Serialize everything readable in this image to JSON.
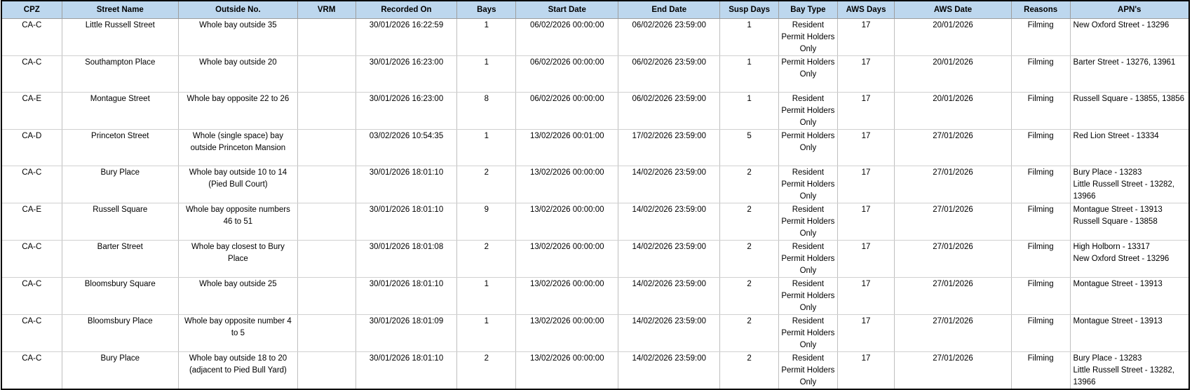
{
  "columns": [
    "CPZ",
    "Street Name",
    "Outside No.",
    "VRM",
    "Recorded On",
    "Bays",
    "Start Date",
    "End Date",
    "Susp Days",
    "Bay Type",
    "AWS Days",
    "AWS Date",
    "Reasons",
    "APN's"
  ],
  "rows": [
    {
      "cpz": "CA-C",
      "street": "Little Russell Street",
      "outside": "Whole bay outside 35",
      "vrm": "",
      "recorded": "30/01/2026 16:22:59",
      "bays": "1",
      "start": "06/02/2026 00:00:00",
      "end": "06/02/2026 23:59:00",
      "susp": "1",
      "bay_type": "Resident Permit Holders Only",
      "aws_days": "17",
      "aws_date": "20/01/2026",
      "reason": "Filming",
      "apns": [
        "New Oxford Street - 13296"
      ]
    },
    {
      "cpz": "CA-C",
      "street": "Southampton Place",
      "outside": "Whole bay outside 20",
      "vrm": "",
      "recorded": "30/01/2026 16:23:00",
      "bays": "1",
      "start": "06/02/2026 00:00:00",
      "end": "06/02/2026 23:59:00",
      "susp": "1",
      "bay_type": "Permit Holders Only",
      "aws_days": "17",
      "aws_date": "20/01/2026",
      "reason": "Filming",
      "apns": [
        "Barter Street - 13276, 13961"
      ]
    },
    {
      "cpz": "CA-E",
      "street": "Montague Street",
      "outside": "Whole bay opposite 22 to 26",
      "vrm": "",
      "recorded": "30/01/2026 16:23:00",
      "bays": "8",
      "start": "06/02/2026 00:00:00",
      "end": "06/02/2026 23:59:00",
      "susp": "1",
      "bay_type": "Resident Permit Holders Only",
      "aws_days": "17",
      "aws_date": "20/01/2026",
      "reason": "Filming",
      "apns": [
        "Russell Square - 13855, 13856"
      ]
    },
    {
      "cpz": "CA-D",
      "street": "Princeton Street",
      "outside": "Whole (single space) bay outside Princeton Mansion",
      "vrm": "",
      "recorded": "03/02/2026 10:54:35",
      "bays": "1",
      "start": "13/02/2026 00:01:00",
      "end": "17/02/2026 23:59:00",
      "susp": "5",
      "bay_type": "Permit Holders Only",
      "aws_days": "17",
      "aws_date": "27/01/2026",
      "reason": "Filming",
      "apns": [
        "Red Lion Street - 13334"
      ]
    },
    {
      "cpz": "CA-C",
      "street": "Bury Place",
      "outside": "Whole bay outside 10 to 14 (Pied Bull Court)",
      "vrm": "",
      "recorded": "30/01/2026 18:01:10",
      "bays": "2",
      "start": "13/02/2026 00:00:00",
      "end": "14/02/2026 23:59:00",
      "susp": "2",
      "bay_type": "Resident Permit Holders Only",
      "aws_days": "17",
      "aws_date": "27/01/2026",
      "reason": "Filming",
      "apns": [
        "Bury Place - 13283",
        "Little Russell Street - 13282, 13966"
      ]
    },
    {
      "cpz": "CA-E",
      "street": "Russell Square",
      "outside": "Whole bay opposite numbers 46 to 51",
      "vrm": "",
      "recorded": "30/01/2026 18:01:10",
      "bays": "9",
      "start": "13/02/2026 00:00:00",
      "end": "14/02/2026 23:59:00",
      "susp": "2",
      "bay_type": "Resident Permit Holders Only",
      "aws_days": "17",
      "aws_date": "27/01/2026",
      "reason": "Filming",
      "apns": [
        "Montague Street - 13913",
        "Russell Square - 13858"
      ]
    },
    {
      "cpz": "CA-C",
      "street": "Barter Street",
      "outside": "Whole bay closest to Bury Place",
      "vrm": "",
      "recorded": "30/01/2026 18:01:08",
      "bays": "2",
      "start": "13/02/2026 00:00:00",
      "end": "14/02/2026 23:59:00",
      "susp": "2",
      "bay_type": "Resident Permit Holders Only",
      "aws_days": "17",
      "aws_date": "27/01/2026",
      "reason": "Filming",
      "apns": [
        "High Holborn - 13317",
        "New Oxford Street - 13296"
      ]
    },
    {
      "cpz": "CA-C",
      "street": "Bloomsbury Square",
      "outside": "Whole bay outside 25",
      "vrm": "",
      "recorded": "30/01/2026 18:01:10",
      "bays": "1",
      "start": "13/02/2026 00:00:00",
      "end": "14/02/2026 23:59:00",
      "susp": "2",
      "bay_type": "Resident Permit Holders Only",
      "aws_days": "17",
      "aws_date": "27/01/2026",
      "reason": "Filming",
      "apns": [
        "Montague Street - 13913"
      ]
    },
    {
      "cpz": "CA-C",
      "street": "Bloomsbury Place",
      "outside": "Whole bay opposite number 4 to 5",
      "vrm": "",
      "recorded": "30/01/2026 18:01:09",
      "bays": "1",
      "start": "13/02/2026 00:00:00",
      "end": "14/02/2026 23:59:00",
      "susp": "2",
      "bay_type": "Resident Permit Holders Only",
      "aws_days": "17",
      "aws_date": "27/01/2026",
      "reason": "Filming",
      "apns": [
        "Montague Street - 13913"
      ]
    },
    {
      "cpz": "CA-C",
      "street": "Bury Place",
      "outside": "Whole bay outside 18 to 20 (adjacent to Pied Bull Yard)",
      "vrm": "",
      "recorded": "30/01/2026 18:01:10",
      "bays": "2",
      "start": "13/02/2026 00:00:00",
      "end": "14/02/2026 23:59:00",
      "susp": "2",
      "bay_type": "Resident Permit Holders Only",
      "aws_days": "17",
      "aws_date": "27/01/2026",
      "reason": "Filming",
      "apns": [
        "Bury Place - 13283",
        "Little Russell Street - 13282, 13966"
      ]
    }
  ]
}
